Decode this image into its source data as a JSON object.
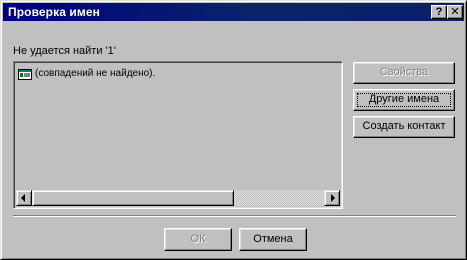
{
  "window": {
    "title": "Проверка имен",
    "help_glyph": "?",
    "close_glyph": "✕"
  },
  "message": "Не удается найти '1'",
  "list": {
    "items": [
      {
        "icon": "address-card-icon",
        "label": "(совпадений не найдено)."
      }
    ]
  },
  "side_buttons": {
    "properties_label": "Свойства",
    "other_names_label": "Другие имена",
    "create_contact_label": "Создать контакт"
  },
  "footer": {
    "ok_label": "ОК",
    "cancel_label": "Отмена"
  },
  "colors": {
    "title_bar": "#000080",
    "dialog_face": "#c0c0c0",
    "disabled_text": "#808080"
  }
}
